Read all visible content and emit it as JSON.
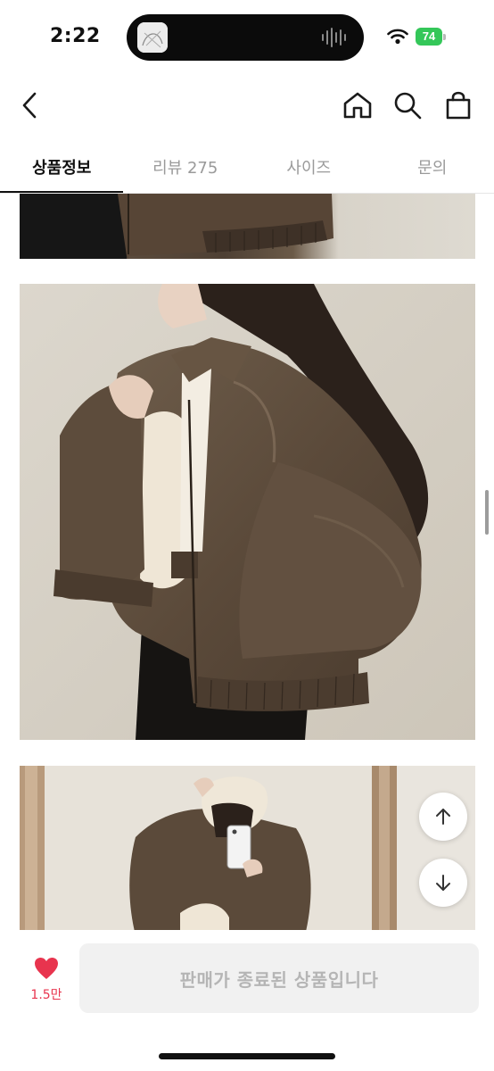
{
  "status_bar": {
    "time": "2:22",
    "battery": "74",
    "battery_color": "#34c759"
  },
  "nav": {
    "back_icon": "chevron-left-icon",
    "home_icon": "home-icon",
    "search_icon": "search-icon",
    "cart_icon": "shopping-bag-icon"
  },
  "tabs": [
    {
      "label": "상품정보",
      "active": true
    },
    {
      "label": "리뷰 275",
      "active": false
    },
    {
      "label": "사이즈",
      "active": false
    },
    {
      "label": "문의",
      "active": false
    }
  ],
  "float_buttons": {
    "up_icon": "arrow-up-icon",
    "down_icon": "arrow-down-icon"
  },
  "bottom_bar": {
    "like_icon": "heart-icon",
    "like_count": "1.5만",
    "like_color": "#e8344e",
    "sold_out_label": "판매가 종료된 상품입니다"
  }
}
